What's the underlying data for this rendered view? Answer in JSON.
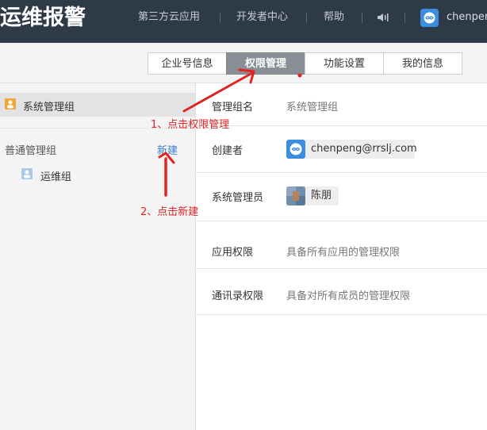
{
  "header": {
    "app_title": "运维报警",
    "nav": [
      {
        "label": "第三方云应用"
      },
      {
        "label": "开发者中心"
      },
      {
        "label": "帮助"
      }
    ],
    "user_name": "chenpeng"
  },
  "tabs": [
    {
      "label": "企业号信息",
      "active": false
    },
    {
      "label": "权限管理",
      "active": true
    },
    {
      "label": "功能设置",
      "active": false
    },
    {
      "label": "我的信息",
      "active": false
    }
  ],
  "sidebar": {
    "system_group": "系统管理组",
    "normal_group_title": "普通管理组",
    "new_label": "新建",
    "groups": [
      {
        "label": "运维组"
      }
    ]
  },
  "detail": {
    "rows": [
      {
        "label": "管理组名",
        "value": "系统管理组"
      },
      {
        "label": "创建者",
        "value": "chenpeng@rrslj.com"
      },
      {
        "label": "系统管理员",
        "value": "陈朋"
      },
      {
        "label": "应用权限",
        "value": "具备所有应用的管理权限"
      },
      {
        "label": "通讯录权限",
        "value": "具备对所有成员的管理权限"
      }
    ]
  },
  "annotations": {
    "step1": "1、点击权限管理",
    "step2": "2、点击新建"
  },
  "colors": {
    "topbar": "#2f3a48",
    "active_tab": "#8a8f97",
    "link": "#3b7fd1",
    "annotation": "#e02424"
  },
  "icons": [
    "speaker-icon",
    "user-avatar-icon",
    "group-icon",
    "avatar-icon"
  ]
}
